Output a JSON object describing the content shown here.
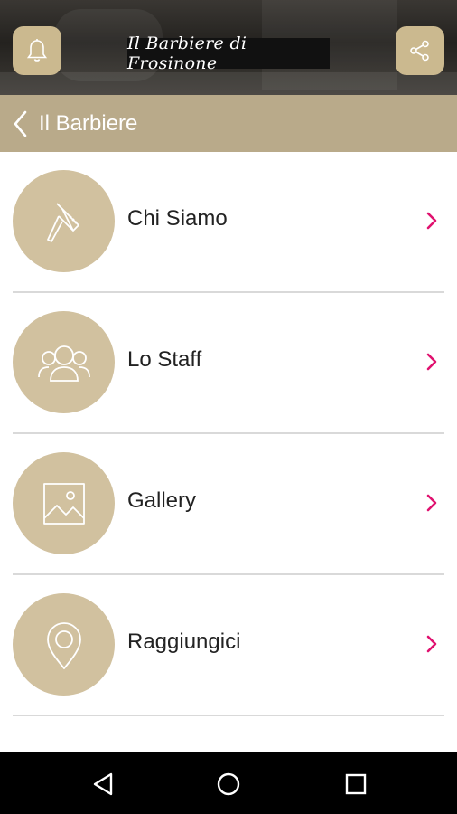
{
  "header": {
    "logo_text": "Il Barbiere di Frosinone",
    "notification_icon": "bell-icon",
    "share_icon": "share-icon"
  },
  "navbar": {
    "title": "Il Barbiere",
    "back_icon": "chevron-left-icon"
  },
  "menu": {
    "items": [
      {
        "label": "Chi Siamo",
        "icon": "razor-icon"
      },
      {
        "label": "Lo Staff",
        "icon": "people-icon"
      },
      {
        "label": "Gallery",
        "icon": "image-icon"
      },
      {
        "label": "Raggiungici",
        "icon": "location-pin-icon"
      }
    ]
  },
  "colors": {
    "accent_gold": "#cbb98f",
    "navbar": "#b9aa8a",
    "circle": "#d1c19f",
    "chevron": "#e0116f"
  },
  "system_nav": {
    "back_icon": "triangle-back-icon",
    "home_icon": "circle-home-icon",
    "recents_icon": "square-recents-icon"
  }
}
